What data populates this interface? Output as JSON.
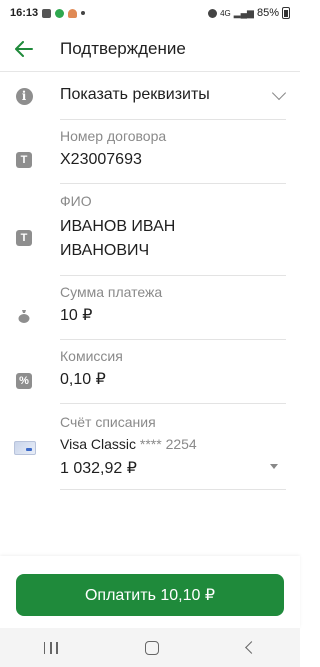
{
  "status_bar": {
    "time": "16:13",
    "network": "4G",
    "battery": "85%"
  },
  "header": {
    "title": "Подтверждение",
    "back_icon": "arrow-left-icon",
    "accent_color": "#1f8a3b"
  },
  "requisites": {
    "label": "Показать реквизиты",
    "icon": "info-icon"
  },
  "fields": {
    "contract": {
      "label": "Номер договора",
      "value": "X23007693",
      "icon": "text-t-icon"
    },
    "fio": {
      "label": "ФИО",
      "value_line1": "ИВАНОВ ИВАН",
      "value_line2": "ИВАНОВИЧ",
      "icon": "text-t-icon"
    },
    "amount": {
      "label": "Сумма платежа",
      "value": "10 ₽",
      "icon": "money-bag-icon"
    },
    "commission": {
      "label": "Комиссия",
      "value": "0,10 ₽",
      "icon": "percent-icon"
    },
    "account": {
      "label": "Счёт списания",
      "card_name": "Visa Classic",
      "card_mask": "**** 2254",
      "balance": "1 032,92 ₽",
      "icon": "card-icon"
    }
  },
  "pay_button": {
    "label": "Оплатить 10,10 ₽"
  }
}
